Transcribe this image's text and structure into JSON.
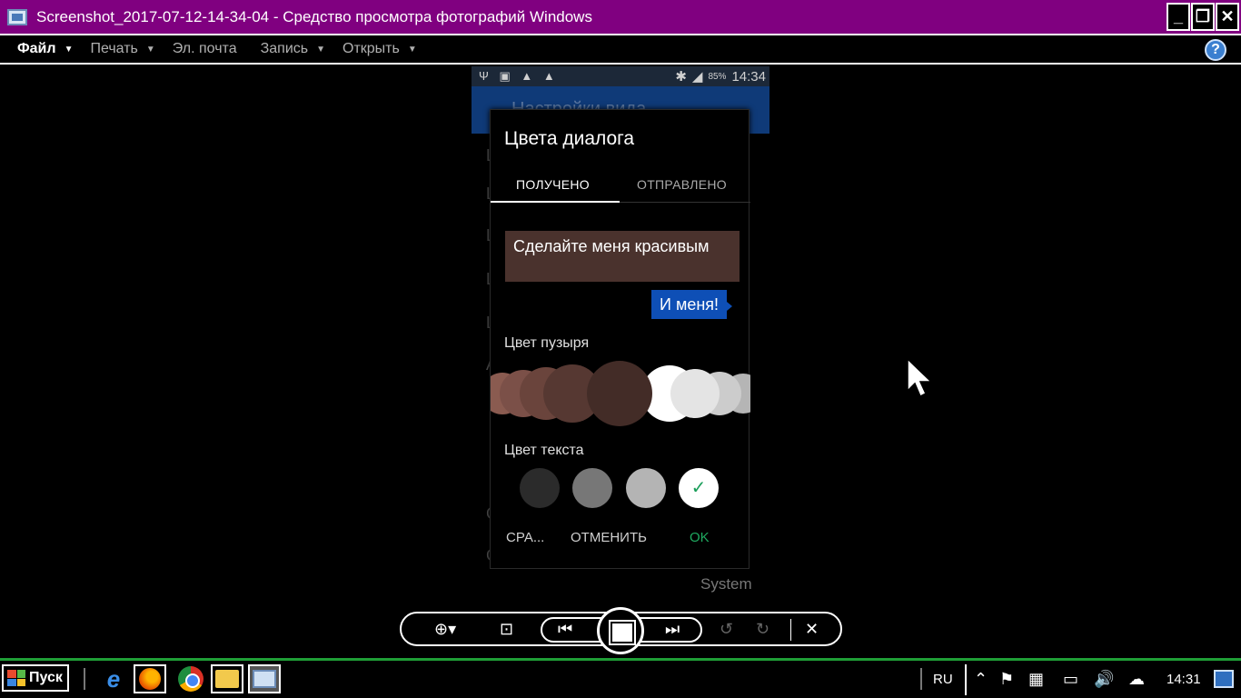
{
  "window": {
    "title": "Screenshot_2017-07-12-14-34-04 - Средство просмотра фотографий Windows",
    "buttons": {
      "minimize": "_",
      "restore": "❐",
      "close": "✕"
    }
  },
  "menu": {
    "file": "Файл",
    "print": "Печать",
    "email": "Эл. почта",
    "burn": "Запись",
    "open": "Открыть",
    "help_icon": "help-icon",
    "help_label": "?"
  },
  "phone": {
    "status": {
      "left_icons": "Ψ ▣ ▲ ▲",
      "bluetooth": "✱",
      "signal": "◢",
      "battery": "85%",
      "time": "14:34"
    },
    "background": {
      "appbar_title": "Настройки вида",
      "system_label": "System"
    },
    "dialog": {
      "title": "Цвета диалога",
      "tabs": [
        "ПОЛУЧЕНО",
        "ОТПРАВЛЕНО"
      ],
      "active_tab": 0,
      "bubble_received": "Сделайте меня красивым",
      "bubble_sent": "И меня!",
      "bubble_color_label": "Цвет пузыря",
      "text_color_label": "Цвет текста",
      "bubble_colors": [
        "#8a5b50",
        "#7b5048",
        "#6a443c",
        "#563832",
        "#432c27",
        "#ffffff",
        "#e4e4e4",
        "#cccccc",
        "#b5b5b5"
      ],
      "selected_bubble_color": "#432c27",
      "text_colors": [
        "#2b2b2b",
        "#777777",
        "#b4b4b4",
        "#ffffff"
      ],
      "selected_text_color": "#ffffff",
      "check_mark": "✓",
      "buttons": {
        "reset": "СРА...",
        "cancel": "ОТМЕНИТЬ",
        "ok": "OK"
      }
    }
  },
  "viewer_controls": {
    "zoom": "⊕▾",
    "fit": "⊡",
    "prev": "⏮",
    "next": "⏭",
    "rotate_left": "↺",
    "rotate_right": "↻",
    "delete": "✕"
  },
  "taskbar": {
    "start_label": "Пуск",
    "language": "RU",
    "tray_icons": [
      "⌃",
      "⚑",
      "▦",
      "▭",
      "🔊",
      "☁"
    ],
    "clock": "14:31"
  },
  "colors": {
    "title_bg": "#800080",
    "taskbar_border": "#1f9e36",
    "accent_blue": "#0e4fb6",
    "ok_green": "#1faa60"
  }
}
